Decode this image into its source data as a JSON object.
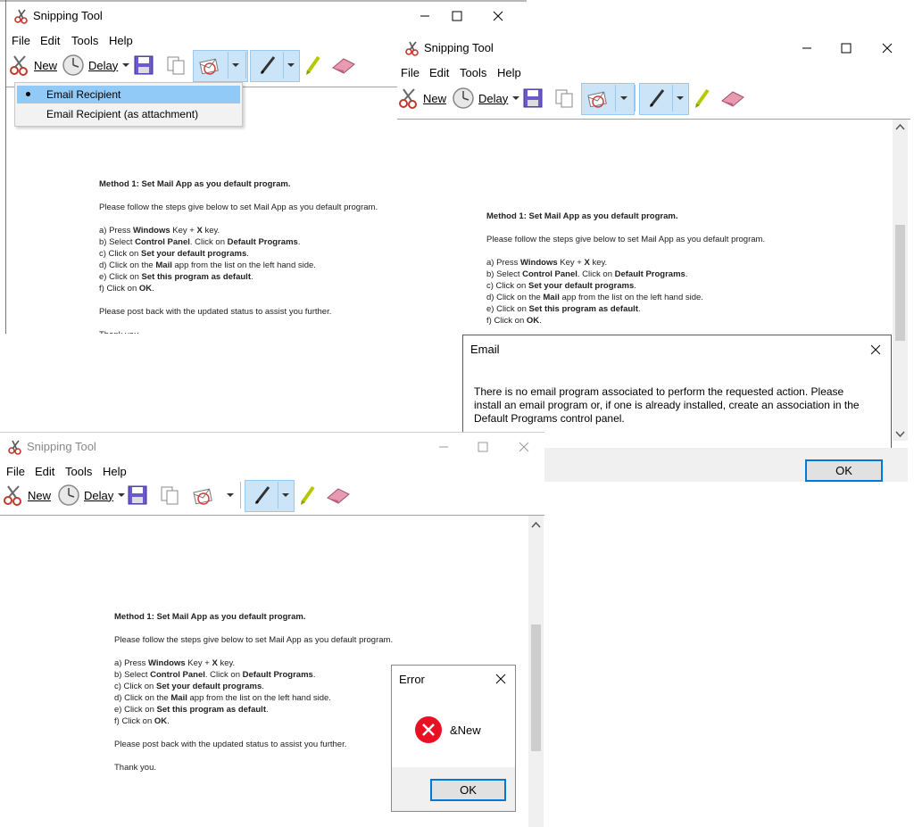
{
  "window1": {
    "title": "Snipping Tool",
    "menu": [
      "File",
      "Edit",
      "Tools",
      "Help"
    ],
    "toolbar": {
      "new_label": "New",
      "delay_label": "Delay"
    },
    "dropdown": {
      "items": [
        "Email Recipient",
        "Email Recipient (as attachment)"
      ],
      "selected_index": 0
    },
    "doc": {
      "heading": "Method 1: Set Mail App as you default program.",
      "intro": "Please follow the steps give below to set Mail App as you default program.",
      "steps": [
        {
          "pre": "a) Press ",
          "b1": "Windows",
          "mid": " Key + ",
          "b2": "X",
          "post": " key."
        },
        {
          "pre": "b) Select ",
          "b1": "Control Panel",
          "mid": ". Click on ",
          "b2": "Default Programs",
          "post": "."
        },
        {
          "pre": "c) Click on ",
          "b1": "Set your default programs",
          "mid": ".",
          "b2": "",
          "post": ""
        },
        {
          "pre": "d) Click on the ",
          "b1": "Mail",
          "mid": " app from the list on the left hand side.",
          "b2": "",
          "post": ""
        },
        {
          "pre": "e) Click on ",
          "b1": "Set this program as default",
          "mid": ".",
          "b2": "",
          "post": ""
        },
        {
          "pre": "f) Click on ",
          "b1": "OK",
          "mid": ".",
          "b2": "",
          "post": ""
        }
      ],
      "outro": "Please post back with the updated status to assist you further.",
      "thanks": "Thank you."
    }
  },
  "window2": {
    "title": "Snipping Tool",
    "menu": [
      "File",
      "Edit",
      "Tools",
      "Help"
    ],
    "toolbar": {
      "new_label": "New",
      "delay_label": "Delay"
    }
  },
  "email_dialog": {
    "title": "Email",
    "message": "There is no email program associated to perform the requested action. Please install an email program or, if one is already installed, create an association in the Default Programs control panel.",
    "ok_label": "OK"
  },
  "window3": {
    "title": "Snipping Tool",
    "menu": [
      "File",
      "Edit",
      "Tools",
      "Help"
    ],
    "toolbar": {
      "new_label": "New",
      "delay_label": "Delay"
    }
  },
  "error_dialog": {
    "title": "Error",
    "message": "&New",
    "ok_label": "OK"
  },
  "colors": {
    "accent": "#0078d7",
    "highlight": "#cce4f7",
    "error_red": "#e81123"
  },
  "icons": [
    "scissors-icon",
    "clock-icon",
    "save-icon",
    "copy-icon",
    "send-snip-icon",
    "pen-icon",
    "highlighter-icon",
    "eraser-icon",
    "close-icon",
    "maximize-icon",
    "minimize-icon",
    "chevron-down-icon",
    "error-icon"
  ]
}
